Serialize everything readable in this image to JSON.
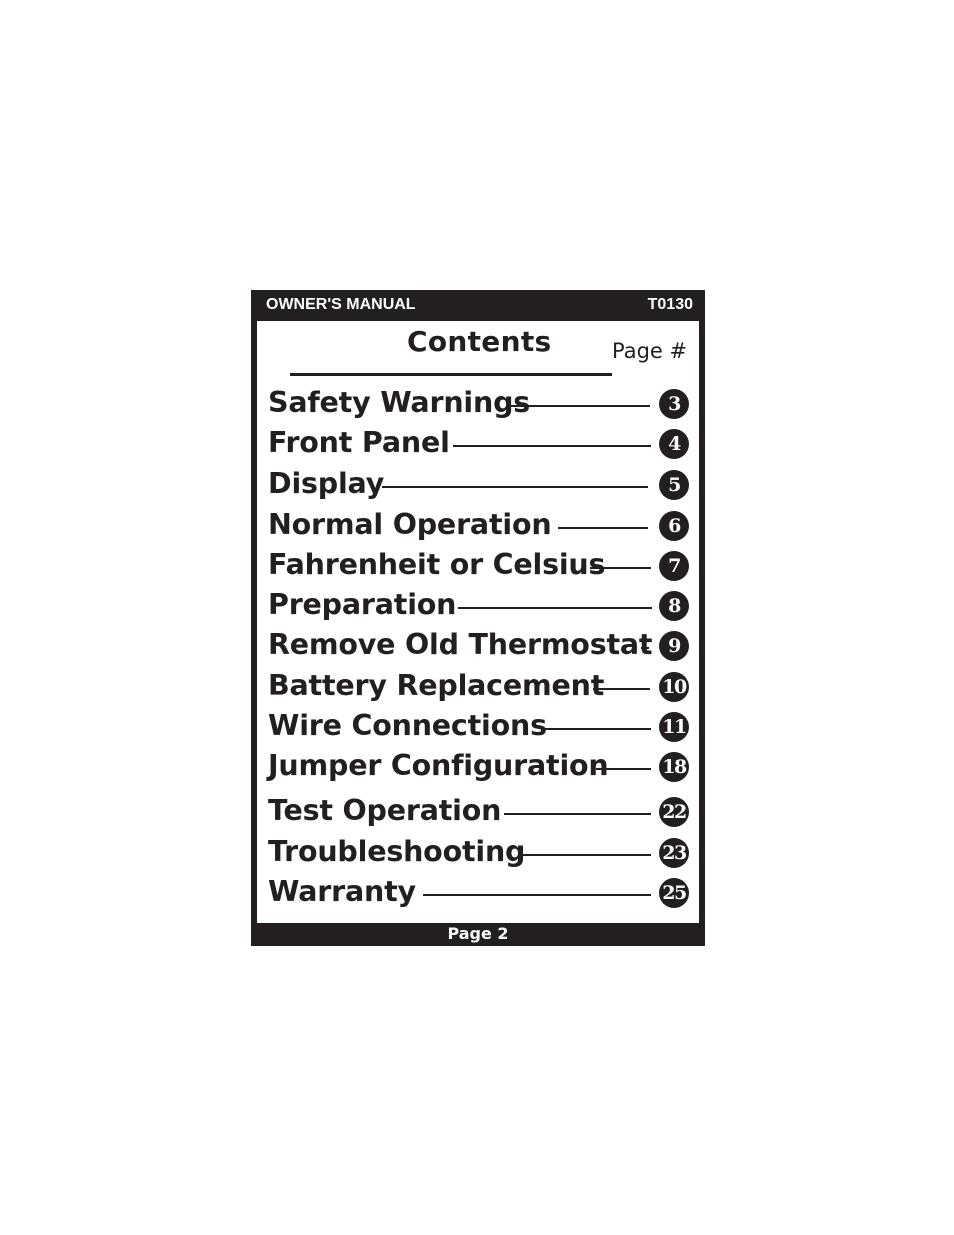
{
  "header": {
    "title": "OWNER'S MANUAL",
    "model": "T0130"
  },
  "contents": {
    "title": "Contents",
    "page_label": "Page #",
    "entries": [
      {
        "label": "Safety Warnings",
        "page": "3"
      },
      {
        "label": "Front Panel",
        "page": "4"
      },
      {
        "label": "Display",
        "page": "5"
      },
      {
        "label": "Normal Operation",
        "page": "6"
      },
      {
        "label": "Fahrenheit or Celsius",
        "page": "7"
      },
      {
        "label": "Preparation",
        "page": "8"
      },
      {
        "label": "Remove Old Thermostat",
        "page": "9"
      },
      {
        "label": "Battery Replacement",
        "page": "10"
      },
      {
        "label": "Wire Connections",
        "page": "11"
      },
      {
        "label": "Jumper Configuration",
        "page": "18"
      },
      {
        "label": "Test Operation",
        "page": "22"
      },
      {
        "label": "Troubleshooting",
        "page": "23"
      },
      {
        "label": "Warranty",
        "page": "25"
      }
    ]
  },
  "footer": {
    "page": "Page 2"
  }
}
